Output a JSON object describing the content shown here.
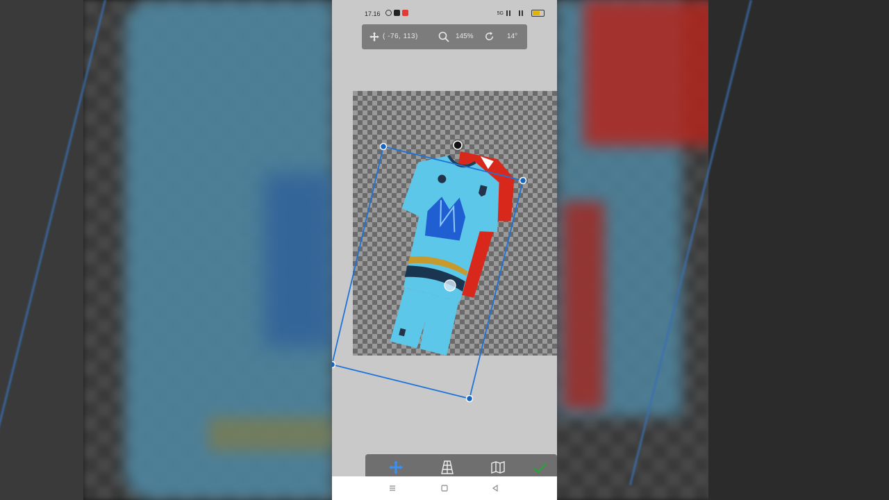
{
  "status_bar": {
    "time": "17.16",
    "app_icons": [
      "whatsapp-icon",
      "youtube-icon",
      "notification-icon"
    ],
    "network_label": "5G",
    "battery_level": 0.6,
    "battery_color": "#e0b400"
  },
  "transform_toolbar": {
    "coords": "( -76,  113)",
    "zoom": "145%",
    "angle": "14°"
  },
  "colors": {
    "accent": "#1565c0",
    "handle_fill": "#1565c0",
    "confirm": "#2e9e3e",
    "phone_bg": "#c9c9c9",
    "toolbar_bg": "#7c7c7c"
  },
  "layer": {
    "subject": "football jersey mockup",
    "shirt_color": "#5cc7e8",
    "back_shirt_color": "#d8281c"
  },
  "bottom_tools": [
    "move-tool-icon",
    "perspective-tool-icon",
    "warp-tool-icon",
    "confirm-check-icon"
  ],
  "nav_buttons": [
    "menu-icon",
    "home-icon",
    "back-icon"
  ]
}
